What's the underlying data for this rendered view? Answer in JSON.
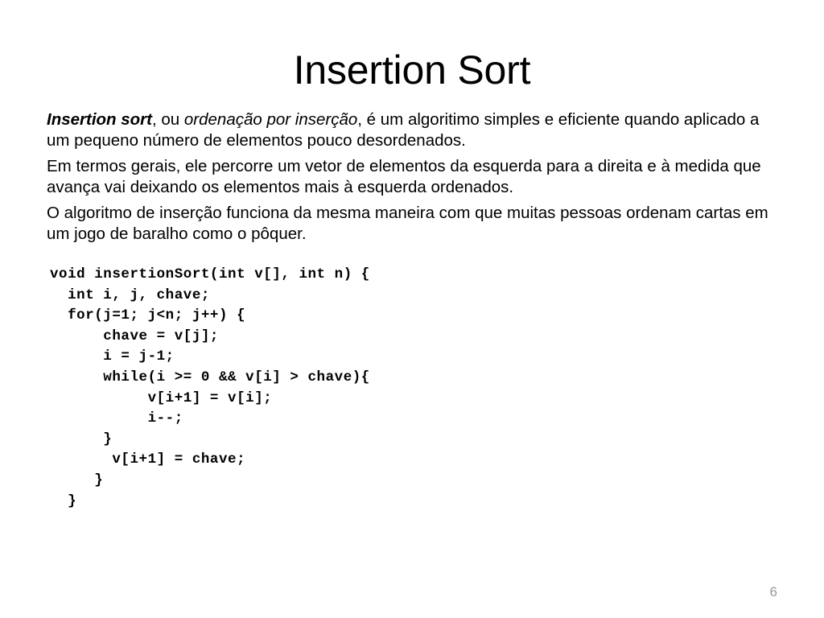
{
  "slide": {
    "title": "Insertion Sort",
    "page_number": "6",
    "background_color": "#ffffff",
    "text_color": "#000000",
    "page_number_color": "#9a9a9a"
  },
  "paragraphs": [
    {
      "id": "definition",
      "runs": [
        {
          "text": "Insertion sort",
          "style": "bold-italic"
        },
        {
          "text": ", ou ",
          "style": "regular"
        },
        {
          "text": "ordenação por inserção",
          "style": "italic"
        },
        {
          "text": ", é um algoritimo simples e eficiente quando aplicado a um pequeno número de elementos pouco desordenados.",
          "style": "regular"
        }
      ],
      "plain": "Insertion sort, ou ordenação por inserção, é um algoritimo simples e eficiente quando aplicado a um pequeno número de elementos pouco desordenados."
    },
    {
      "id": "behaviour",
      "runs": [
        {
          "text": "Em termos gerais, ele percorre um vetor de elementos da esquerda para a direita e à medida que avança vai deixando os elementos mais à esquerda ordenados.",
          "style": "regular"
        }
      ],
      "plain": "Em termos gerais, ele percorre um vetor de elementos da esquerda para a direita e à medida que avança vai deixando os elementos mais à esquerda ordenados."
    },
    {
      "id": "analogy",
      "runs": [
        {
          "text": "O algoritmo de inserção funciona da mesma maneira com que muitas pessoas ordenam cartas em um jogo de baralho como o pôquer.",
          "style": "regular"
        }
      ],
      "plain": "O algoritmo de inserção funciona da mesma maneira com que muitas pessoas ordenam cartas em um jogo de baralho como o pôquer."
    }
  ],
  "code": {
    "language": "C",
    "lines": [
      "void insertionSort(int v[], int n) {",
      "  int i, j, chave;",
      "  for(j=1; j<n; j++) {",
      "      chave = v[j];",
      "      i = j-1;",
      "      while(i >= 0 && v[i] > chave){",
      "           v[i+1] = v[i];",
      "           i--;",
      "      }",
      "       v[i+1] = chave;",
      "     }",
      "  }"
    ]
  }
}
